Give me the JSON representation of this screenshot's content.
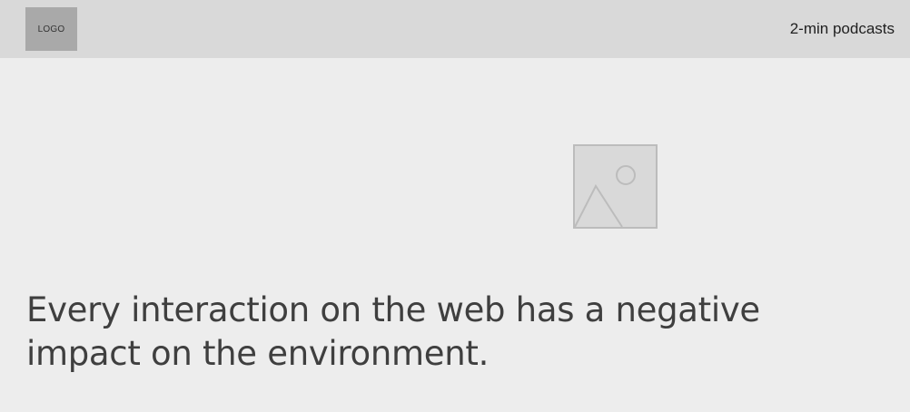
{
  "header": {
    "logo_label": "LOGO",
    "nav_link": "2-min podcasts"
  },
  "hero": {
    "image_icon": "image-placeholder-icon",
    "headline": "Every interaction on the web has a negative impact on the environment."
  },
  "colors": {
    "header_bg": "#d9d9d9",
    "page_bg": "#ededed",
    "logo_bg": "#a9a9a9",
    "text": "#3f3f3f"
  }
}
